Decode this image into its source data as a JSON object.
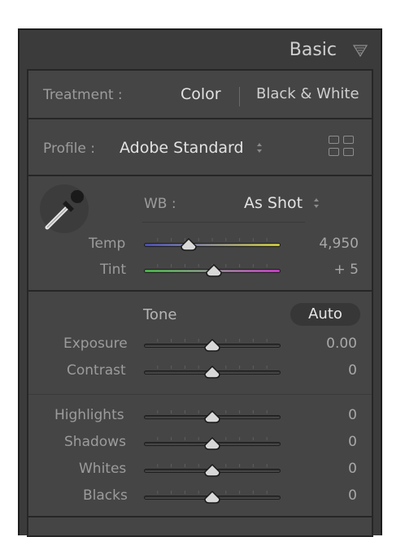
{
  "header": {
    "title": "Basic"
  },
  "treatment": {
    "label": "Treatment :",
    "option_color": "Color",
    "option_bw": "Black & White"
  },
  "profile": {
    "label": "Profile :",
    "value": "Adobe Standard"
  },
  "white_balance": {
    "label": "WB :",
    "value": "As Shot",
    "temp": {
      "label": "Temp",
      "value": "4,950",
      "level": 0.33
    },
    "tint": {
      "label": "Tint",
      "value": "+ 5",
      "level": 0.51
    }
  },
  "tone": {
    "label": "Tone",
    "auto_label": "Auto",
    "exposure": {
      "label": "Exposure",
      "value": "0.00",
      "level": 0.5
    },
    "contrast": {
      "label": "Contrast",
      "value": "0",
      "level": 0.5
    }
  },
  "presence": {
    "highlights": {
      "label": "Highlights",
      "value": "0",
      "level": 0.5
    },
    "shadows": {
      "label": "Shadows",
      "value": "0",
      "level": 0.5
    },
    "whites": {
      "label": "Whites",
      "value": "0",
      "level": 0.5
    },
    "blacks": {
      "label": "Blacks",
      "value": "0",
      "level": 0.5
    }
  },
  "colors": {
    "panel": "#454545",
    "text": "#c2c2c2",
    "temp_start": "#4a4fb0",
    "temp_end": "#c8c43c",
    "tint_start": "#46b446",
    "tint_end": "#c43cc4"
  },
  "icons": [
    "triangle-collapse-icon",
    "grid-view-icon",
    "eyedropper-icon",
    "stepper-arrows-icon",
    "slider-thumb-icon"
  ]
}
